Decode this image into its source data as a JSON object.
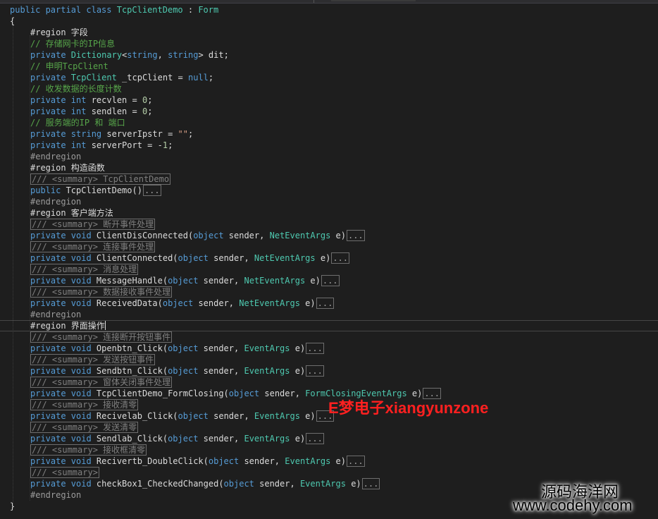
{
  "editor": {
    "lines": [
      [
        {
          "t": "public partial class ",
          "c": "k"
        },
        {
          "t": "TcpClientDemo",
          "c": "t"
        },
        {
          "t": " : ",
          "c": "d"
        },
        {
          "t": "Form",
          "c": "t"
        }
      ],
      [
        {
          "t": "{",
          "c": "d"
        }
      ],
      [
        {
          "t": "#region 字段",
          "c": "d"
        }
      ],
      [
        {
          "t": "// 存储网卡的IP信息",
          "c": "c"
        }
      ],
      [
        {
          "t": "private ",
          "c": "k"
        },
        {
          "t": "Dictionary",
          "c": "t"
        },
        {
          "t": "<",
          "c": "d"
        },
        {
          "t": "string",
          "c": "k"
        },
        {
          "t": ", ",
          "c": "d"
        },
        {
          "t": "string",
          "c": "k"
        },
        {
          "t": "> dit;",
          "c": "d"
        }
      ],
      [
        {
          "t": "// 申明TcpClient",
          "c": "c"
        }
      ],
      [
        {
          "t": "private ",
          "c": "k"
        },
        {
          "t": "TcpClient",
          "c": "t"
        },
        {
          "t": " _tcpClient = ",
          "c": "d"
        },
        {
          "t": "null",
          "c": "k"
        },
        {
          "t": ";",
          "c": "d"
        }
      ],
      [
        {
          "t": "// 收发数据的长度计数",
          "c": "c"
        }
      ],
      [
        {
          "t": "private ",
          "c": "k"
        },
        {
          "t": "int",
          "c": "k"
        },
        {
          "t": " recvlen = ",
          "c": "d"
        },
        {
          "t": "0",
          "c": "n"
        },
        {
          "t": ";",
          "c": "d"
        }
      ],
      [
        {
          "t": "private ",
          "c": "k"
        },
        {
          "t": "int",
          "c": "k"
        },
        {
          "t": " sendlen = ",
          "c": "d"
        },
        {
          "t": "0",
          "c": "n"
        },
        {
          "t": ";",
          "c": "d"
        }
      ],
      [
        {
          "t": "// 服务端的IP 和 端口",
          "c": "c"
        }
      ],
      [
        {
          "t": "private ",
          "c": "k"
        },
        {
          "t": "string",
          "c": "k"
        },
        {
          "t": " serverIpstr = ",
          "c": "d"
        },
        {
          "t": "\"\"",
          "c": "s"
        },
        {
          "t": ";",
          "c": "d"
        }
      ],
      [
        {
          "t": "private ",
          "c": "k"
        },
        {
          "t": "int",
          "c": "k"
        },
        {
          "t": " serverPort = -",
          "c": "d"
        },
        {
          "t": "1",
          "c": "n"
        },
        {
          "t": ";",
          "c": "d"
        }
      ],
      [
        {
          "t": "#endregion",
          "c": "p"
        }
      ],
      [
        {
          "t": "#region 构造函数",
          "c": "d"
        }
      ],
      [
        {
          "t": "/// <summary> TcpClientDemo",
          "c": "box"
        }
      ],
      [
        {
          "t": "public ",
          "c": "k"
        },
        {
          "t": "TcpClientDemo()",
          "c": "d"
        },
        {
          "t": "...",
          "c": "ell"
        }
      ],
      [
        {
          "t": "#endregion",
          "c": "p"
        }
      ],
      [
        {
          "t": "#region 客户端方法",
          "c": "d"
        }
      ],
      [
        {
          "t": "/// <summary> 断开事件处理",
          "c": "box"
        }
      ],
      [
        {
          "t": "private ",
          "c": "k"
        },
        {
          "t": "void",
          "c": "k"
        },
        {
          "t": " ClientDisConnected(",
          "c": "d"
        },
        {
          "t": "object",
          "c": "k"
        },
        {
          "t": " sender, ",
          "c": "d"
        },
        {
          "t": "NetEventArgs",
          "c": "t"
        },
        {
          "t": " e)",
          "c": "d"
        },
        {
          "t": "...",
          "c": "ell"
        }
      ],
      [
        {
          "t": "/// <summary> 连接事件处理",
          "c": "box"
        }
      ],
      [
        {
          "t": "private ",
          "c": "k"
        },
        {
          "t": "void",
          "c": "k"
        },
        {
          "t": " ClientConnected(",
          "c": "d"
        },
        {
          "t": "object",
          "c": "k"
        },
        {
          "t": " sender, ",
          "c": "d"
        },
        {
          "t": "NetEventArgs",
          "c": "t"
        },
        {
          "t": " e)",
          "c": "d"
        },
        {
          "t": "...",
          "c": "ell"
        }
      ],
      [
        {
          "t": "/// <summary> 消息处理",
          "c": "box"
        }
      ],
      [
        {
          "t": "private ",
          "c": "k"
        },
        {
          "t": "void",
          "c": "k"
        },
        {
          "t": " MessageHandle(",
          "c": "d"
        },
        {
          "t": "object",
          "c": "k"
        },
        {
          "t": " sender, ",
          "c": "d"
        },
        {
          "t": "NetEventArgs",
          "c": "t"
        },
        {
          "t": " e)",
          "c": "d"
        },
        {
          "t": "...",
          "c": "ell"
        }
      ],
      [
        {
          "t": "/// <summary> 数据接收事件处理",
          "c": "box"
        }
      ],
      [
        {
          "t": "private ",
          "c": "k"
        },
        {
          "t": "void",
          "c": "k"
        },
        {
          "t": " ReceivedData(",
          "c": "d"
        },
        {
          "t": "object",
          "c": "k"
        },
        {
          "t": " sender, ",
          "c": "d"
        },
        {
          "t": "NetEventArgs",
          "c": "t"
        },
        {
          "t": " e)",
          "c": "d"
        },
        {
          "t": "...",
          "c": "ell"
        }
      ],
      [
        {
          "t": "#endregion",
          "c": "p"
        }
      ],
      [
        {
          "t": "#region 界面操作",
          "c": "d"
        }
      ],
      [
        {
          "t": "/// <summary> 连接断开按钮事件",
          "c": "box"
        }
      ],
      [
        {
          "t": "private ",
          "c": "k"
        },
        {
          "t": "void",
          "c": "k"
        },
        {
          "t": " Openbtn_Click(",
          "c": "d"
        },
        {
          "t": "object",
          "c": "k"
        },
        {
          "t": " sender, ",
          "c": "d"
        },
        {
          "t": "EventArgs",
          "c": "t"
        },
        {
          "t": " e)",
          "c": "d"
        },
        {
          "t": "...",
          "c": "ell"
        }
      ],
      [
        {
          "t": "/// <summary> 发送按钮事件",
          "c": "box"
        }
      ],
      [
        {
          "t": "private ",
          "c": "k"
        },
        {
          "t": "void",
          "c": "k"
        },
        {
          "t": " Sendbtn_Click(",
          "c": "d"
        },
        {
          "t": "object",
          "c": "k"
        },
        {
          "t": " sender, ",
          "c": "d"
        },
        {
          "t": "EventArgs",
          "c": "t"
        },
        {
          "t": " e)",
          "c": "d"
        },
        {
          "t": "...",
          "c": "ell"
        }
      ],
      [
        {
          "t": "/// <summary> 窗体关闭事件处理",
          "c": "box"
        }
      ],
      [
        {
          "t": "private ",
          "c": "k"
        },
        {
          "t": "void",
          "c": "k"
        },
        {
          "t": " TcpClientDemo_FormClosing(",
          "c": "d"
        },
        {
          "t": "object",
          "c": "k"
        },
        {
          "t": " sender, ",
          "c": "d"
        },
        {
          "t": "FormClosingEventArgs",
          "c": "t"
        },
        {
          "t": " e)",
          "c": "d"
        },
        {
          "t": "...",
          "c": "ell"
        }
      ],
      [
        {
          "t": "/// <summary> 接收清零",
          "c": "box"
        }
      ],
      [
        {
          "t": "private ",
          "c": "k"
        },
        {
          "t": "void",
          "c": "k"
        },
        {
          "t": " Recivelab_Click(",
          "c": "d"
        },
        {
          "t": "object",
          "c": "k"
        },
        {
          "t": " sender, ",
          "c": "d"
        },
        {
          "t": "EventArgs",
          "c": "t"
        },
        {
          "t": " e)",
          "c": "d"
        },
        {
          "t": "...",
          "c": "ell"
        }
      ],
      [
        {
          "t": "/// <summary> 发送清零",
          "c": "box"
        }
      ],
      [
        {
          "t": "private ",
          "c": "k"
        },
        {
          "t": "void",
          "c": "k"
        },
        {
          "t": " Sendlab_Click(",
          "c": "d"
        },
        {
          "t": "object",
          "c": "k"
        },
        {
          "t": " sender, ",
          "c": "d"
        },
        {
          "t": "EventArgs",
          "c": "t"
        },
        {
          "t": " e)",
          "c": "d"
        },
        {
          "t": "...",
          "c": "ell"
        }
      ],
      [
        {
          "t": "/// <summary> 接收框清零",
          "c": "box"
        }
      ],
      [
        {
          "t": "private ",
          "c": "k"
        },
        {
          "t": "void",
          "c": "k"
        },
        {
          "t": " Recivertb_DoubleClick(",
          "c": "d"
        },
        {
          "t": "object",
          "c": "k"
        },
        {
          "t": " sender, ",
          "c": "d"
        },
        {
          "t": "EventArgs",
          "c": "t"
        },
        {
          "t": " e)",
          "c": "d"
        },
        {
          "t": "...",
          "c": "ell"
        }
      ],
      [
        {
          "t": "/// <summary>",
          "c": "box"
        }
      ],
      [
        {
          "t": "private ",
          "c": "k"
        },
        {
          "t": "void",
          "c": "k"
        },
        {
          "t": " checkBox1_CheckedChanged(",
          "c": "d"
        },
        {
          "t": "object",
          "c": "k"
        },
        {
          "t": " sender, ",
          "c": "d"
        },
        {
          "t": "EventArgs",
          "c": "t"
        },
        {
          "t": " e)",
          "c": "d"
        },
        {
          "t": "...",
          "c": "ell"
        }
      ],
      [
        {
          "t": "#endregion",
          "c": "p"
        }
      ],
      [
        {
          "t": "}",
          "c": "d"
        }
      ]
    ]
  },
  "watermarks": {
    "overlay": "E梦电子xiangyunzone",
    "site_name": "源码海洋网",
    "site_url": "www.codehy.com"
  },
  "colors": {
    "background": "#1e1e1e",
    "keyword": "#569cd6",
    "type": "#4ec9b0",
    "comment": "#57a64a",
    "string": "#d69d85",
    "number": "#b5cea8",
    "watermark": "#ff2020"
  }
}
